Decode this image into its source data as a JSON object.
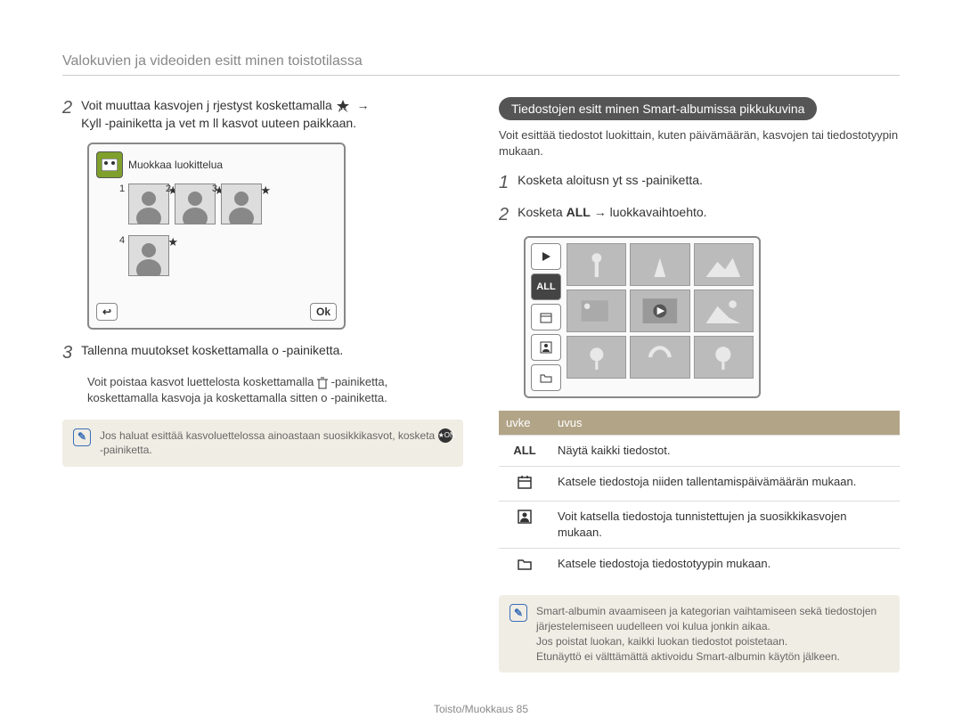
{
  "pageTitle": "Valokuvien ja videoiden esitt minen toistotilassa",
  "left": {
    "step2": "Voit muuttaa kasvojen j rjestyst  koskettamalla",
    "step2b": "Kyll -painiketta ja vet m ll  kasvot uuteen paikkaan.",
    "screenTitle": "Muokkaa luokittelua",
    "faces": [
      {
        "num": "1"
      },
      {
        "num": "2"
      },
      {
        "num": "3"
      },
      {
        "num": "4"
      }
    ],
    "okLabel": "Ok",
    "step3": "Tallenna muutokset koskettamalla o   -painiketta.",
    "indent1": "Voit poistaa kasvot luettelosta koskettamalla",
    "indent1b": "-painiketta,",
    "indent2": "koskettamalla kasvoja ja koskettamalla sitten o   -painiketta.",
    "note": "Jos haluat esittää kasvoluettelossa ainoastaan suosikkikasvot, kosketa",
    "noteEnd": "-painiketta."
  },
  "right": {
    "pill": "Tiedostojen esitt minen Smart-albumissa pikkukuvina",
    "sub": "Voit esittää tiedostot luokittain, kuten päivämäärän, kasvojen tai tiedostotyypin mukaan.",
    "step1": "Kosketa aloitusn yt ss       -painiketta.",
    "step2a": "Kosketa ",
    "step2bold": "ALL",
    "step2b": " → luokkavaihtoehto.",
    "sideAll": "ALL",
    "tableHeader": {
      "c1": "uvke",
      "c2": "uvus"
    },
    "rows": [
      {
        "icon": "ALL",
        "text": "Näytä kaikki tiedostot."
      },
      {
        "icon": "calendar",
        "text": "Katsele tiedostoja niiden tallentamispäivämäärän mukaan."
      },
      {
        "icon": "person",
        "text": "Voit katsella tiedostoja tunnistettujen ja suosikkikasvojen mukaan."
      },
      {
        "icon": "folder",
        "text": "Katsele tiedostoja tiedostotyypin mukaan."
      }
    ],
    "note1": "Smart-albumin avaamiseen ja kategorian vaihtamiseen sekä tiedostojen järjestelemiseen uudelleen voi kulua jonkin aikaa.",
    "note2": "Jos poistat luokan, kaikki luokan tiedostot poistetaan.",
    "note3": "Etunäyttö ei välttämättä aktivoidu Smart-albumin käytön jälkeen."
  },
  "footer": "Toisto/Muokkaus  85"
}
